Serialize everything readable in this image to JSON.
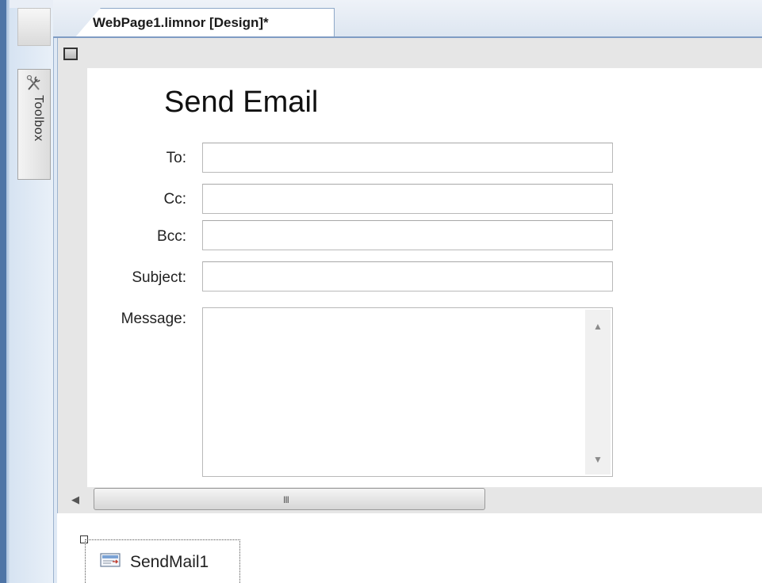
{
  "tab": {
    "title": "WebPage1.limnor [Design]*"
  },
  "toolbox": {
    "label": "Toolbox",
    "icon": "toolbox-icon"
  },
  "form": {
    "heading": "Send Email",
    "fields": {
      "to": {
        "label": "To:",
        "value": ""
      },
      "cc": {
        "label": "Cc:",
        "value": ""
      },
      "bcc": {
        "label": "Bcc:",
        "value": ""
      },
      "subject": {
        "label": "Subject:",
        "value": ""
      },
      "message": {
        "label": "Message:",
        "value": ""
      }
    }
  },
  "scrollbar": {
    "grip": "III"
  },
  "component": {
    "name": "SendMail1",
    "icon": "mail-icon"
  }
}
